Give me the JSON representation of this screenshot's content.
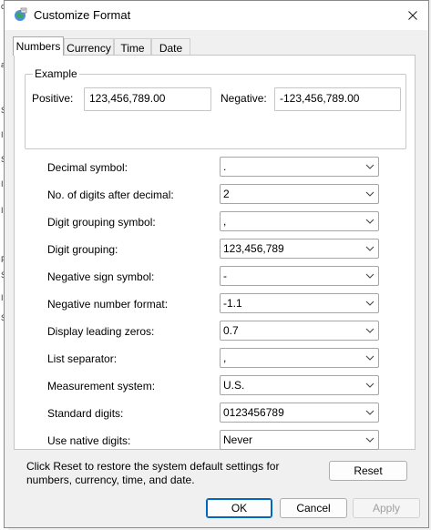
{
  "window": {
    "title": "Customize Format"
  },
  "tabs": [
    {
      "label": "Numbers",
      "active": true
    },
    {
      "label": "Currency",
      "active": false
    },
    {
      "label": "Time",
      "active": false
    },
    {
      "label": "Date",
      "active": false
    }
  ],
  "example": {
    "legend": "Example",
    "positive_label": "Positive:",
    "positive_value": "123,456,789.00",
    "negative_label": "Negative:",
    "negative_value": "-123,456,789.00"
  },
  "settings": [
    {
      "label": "Decimal symbol:",
      "value": "."
    },
    {
      "label": "No. of digits after decimal:",
      "value": "2"
    },
    {
      "label": "Digit grouping symbol:",
      "value": ","
    },
    {
      "label": "Digit grouping:",
      "value": "123,456,789"
    },
    {
      "label": "Negative sign symbol:",
      "value": "-"
    },
    {
      "label": "Negative number format:",
      "value": "-1.1"
    },
    {
      "label": "Display leading zeros:",
      "value": "0.7"
    },
    {
      "label": "List separator:",
      "value": ","
    },
    {
      "label": "Measurement system:",
      "value": "U.S."
    },
    {
      "label": "Standard digits:",
      "value": "0123456789"
    },
    {
      "label": "Use native digits:",
      "value": "Never"
    }
  ],
  "footnote": "Click Reset to restore the system default settings for numbers, currency, time, and date.",
  "buttons": {
    "reset": "Reset",
    "ok": "OK",
    "cancel": "Cancel",
    "apply": "Apply"
  },
  "background_glyphs": [
    "o",
    "a",
    "S",
    "I",
    "S",
    "I",
    "I",
    "F",
    "S",
    "I",
    "S"
  ]
}
